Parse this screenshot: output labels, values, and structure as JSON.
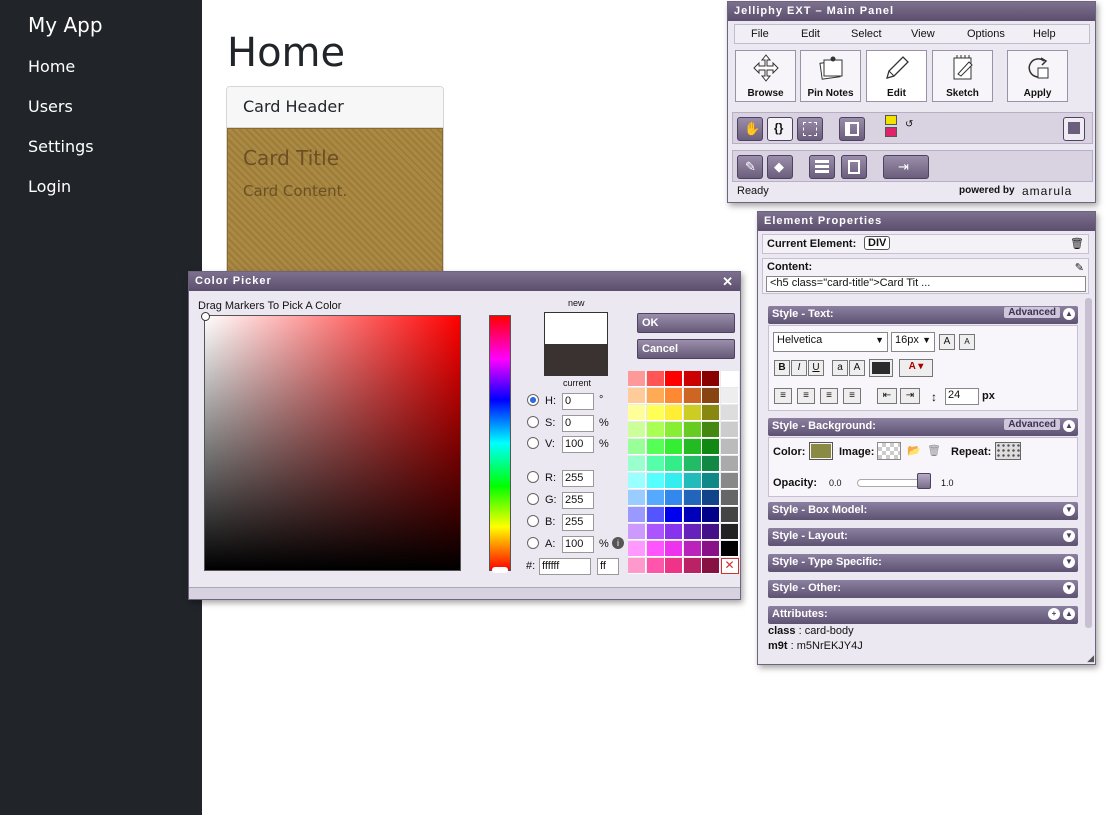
{
  "sidebar": {
    "brand": "My App",
    "items": [
      {
        "label": "Home"
      },
      {
        "label": "Users"
      },
      {
        "label": "Settings"
      },
      {
        "label": "Login"
      }
    ]
  },
  "main": {
    "title": "Home",
    "card": {
      "header": "Card Header",
      "title": "Card Title",
      "content": "Card Content."
    }
  },
  "main_panel": {
    "title": "Jelliphy EXT –  Main Panel",
    "menu": [
      "File",
      "Edit",
      "Select",
      "View",
      "Options",
      "Help"
    ],
    "tools": [
      {
        "label": "Browse",
        "icon": "move-arrows-icon"
      },
      {
        "label": "Pin Notes",
        "icon": "pin-notes-icon"
      },
      {
        "label": "Edit",
        "icon": "pencil-icon"
      },
      {
        "label": "Sketch",
        "icon": "sketch-icon"
      },
      {
        "label": "Apply",
        "icon": "apply-refresh-icon"
      }
    ],
    "status": "Ready",
    "powered_by": "powered by",
    "brand": "amarula"
  },
  "properties": {
    "title": "Element Properties",
    "current_element_label": "Current Element:",
    "current_element_value": "DIV",
    "content_label": "Content:",
    "content_value": "<h5 class=\"card-title\">Card Tit ...",
    "sections": {
      "text": "Style - Text:",
      "background": "Style - Background:",
      "box_model": "Style - Box Model:",
      "layout": "Style - Layout:",
      "type_specific": "Style - Type Specific:",
      "other": "Style - Other:",
      "attributes": "Attributes:"
    },
    "advanced_label": "Advanced",
    "font_family": "Helvetica",
    "font_size": "16px",
    "line_height": "24",
    "line_height_unit": "px",
    "text_color": "#2b2b2b",
    "bg_color_label": "Color:",
    "bg_color": "#8b8a45",
    "image_label": "Image:",
    "repeat_label": "Repeat:",
    "opacity_label": "Opacity:",
    "opacity_min": "0.0",
    "opacity_max": "1.0",
    "opacity_value": 1.0,
    "attributes": [
      {
        "key": "class",
        "value": "card-body"
      },
      {
        "key": "m9t",
        "value": "m5NrEKJY4J"
      }
    ]
  },
  "color_picker": {
    "title": "Color Picker",
    "instruction": "Drag Markers To Pick A Color",
    "new_label": "new",
    "current_label": "current",
    "new_color": "#ffffff",
    "current_color": "#3a3231",
    "ok_label": "OK",
    "cancel_label": "Cancel",
    "fields": [
      {
        "key": "H:",
        "value": "0",
        "unit": "°"
      },
      {
        "key": "S:",
        "value": "0",
        "unit": "%"
      },
      {
        "key": "V:",
        "value": "100",
        "unit": "%"
      },
      {
        "key": "R:",
        "value": "255",
        "unit": ""
      },
      {
        "key": "G:",
        "value": "255",
        "unit": ""
      },
      {
        "key": "B:",
        "value": "255",
        "unit": ""
      },
      {
        "key": "A:",
        "value": "100",
        "unit": "%"
      }
    ],
    "hex_label": "#:",
    "hex_value": "ffffff",
    "alpha_hex": "ff",
    "palette": [
      [
        "#ff9999",
        "#ff5555",
        "#ff0000",
        "#cc0000",
        "#880000",
        "#ffffff"
      ],
      [
        "#ffcc99",
        "#ffaa55",
        "#ff8833",
        "#cc6622",
        "#884411",
        "#eeeeee"
      ],
      [
        "#ffff99",
        "#ffff55",
        "#ffee33",
        "#cccc22",
        "#888811",
        "#dddddd"
      ],
      [
        "#ccff99",
        "#aaff55",
        "#88ee33",
        "#66cc22",
        "#448811",
        "#cccccc"
      ],
      [
        "#99ff99",
        "#55ff55",
        "#33ee33",
        "#22bb22",
        "#118811",
        "#bbbbbb"
      ],
      [
        "#99ffcc",
        "#55ffaa",
        "#33ee88",
        "#22bb66",
        "#118844",
        "#aaaaaa"
      ],
      [
        "#99ffff",
        "#55ffff",
        "#33eeee",
        "#22bbbb",
        "#118888",
        "#888888"
      ],
      [
        "#99ccff",
        "#55aaff",
        "#3388ee",
        "#2266bb",
        "#114488",
        "#666666"
      ],
      [
        "#9999ff",
        "#5555ff",
        "#0000ee",
        "#0000bb",
        "#000088",
        "#444444"
      ],
      [
        "#cc99ff",
        "#aa55ff",
        "#8833ee",
        "#6622bb",
        "#441188",
        "#222222"
      ],
      [
        "#ff99ff",
        "#ff55ff",
        "#ee33ee",
        "#bb22bb",
        "#881188",
        "#000000"
      ],
      [
        "#ff99cc",
        "#ff55aa",
        "#ee3388",
        "#bb2266",
        "#881144",
        "transparent"
      ]
    ]
  }
}
